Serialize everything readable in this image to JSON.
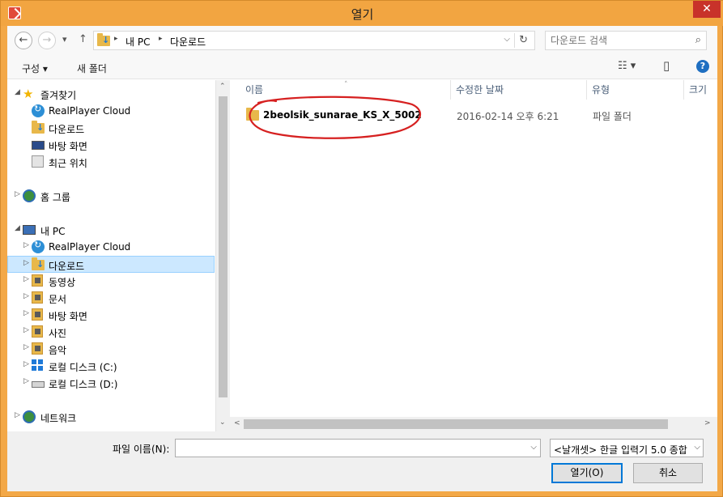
{
  "window": {
    "title": "열기",
    "close_glyph": "✕"
  },
  "nav": {
    "back_glyph": "←",
    "forward_glyph": "→",
    "recent_glyph": "▾",
    "up_glyph": "↑",
    "breadcrumb": [
      "내 PC",
      "다운로드"
    ],
    "crumb_sep": "▸",
    "address_dropdown_glyph": "⌵",
    "refresh_glyph": "↻"
  },
  "search": {
    "placeholder": "다운로드 검색",
    "icon": "⌕"
  },
  "toolbar": {
    "organize_label": "구성 ▾",
    "new_folder_label": "새 폴더",
    "view_glyph": "☷ ▾",
    "pane_glyph": "▯",
    "help_glyph": "?"
  },
  "tree": {
    "favorites": "즐겨찾기",
    "fav_realplayer": "RealPlayer Cloud",
    "fav_downloads": "다운로드",
    "fav_desktop": "바탕 화면",
    "fav_recent": "최근 위치",
    "homegroup": "홈 그룹",
    "this_pc": "내 PC",
    "pc_realplayer": "RealPlayer Cloud",
    "pc_downloads": "다운로드",
    "pc_videos": "동영상",
    "pc_documents": "문서",
    "pc_desktop": "바탕 화면",
    "pc_pictures": "사진",
    "pc_music": "음악",
    "pc_drive_c": "로컬 디스크 (C:)",
    "pc_drive_d": "로컬 디스크 (D:)",
    "network": "네트워크",
    "expanded_glyph": "◢",
    "collapsed_glyph": "▷"
  },
  "columns": {
    "name": "이름",
    "modified": "수정한 날짜",
    "type": "유형",
    "size": "크기",
    "sort_glyph": "˄"
  },
  "files": [
    {
      "name": "2beolsik_sunarae_KS_X_5002",
      "modified": "2016-02-14 오후 6:21",
      "type": "파일 폴더"
    }
  ],
  "footer": {
    "filename_label": "파일 이름(N):",
    "filename_value": "",
    "filter_value": "<날개셋> 한글 입력기 5.0 종합",
    "dropdown_glyph": "⌵",
    "open_label": "열기(O)",
    "cancel_label": "취소"
  },
  "scroll": {
    "up": "⌃",
    "down": "⌄",
    "left": "<",
    "right": ">"
  },
  "colors": {
    "title_bar": "#f2a541",
    "close_button": "#c8322a",
    "selection": "#cce8ff",
    "annotation": "#d62020"
  }
}
